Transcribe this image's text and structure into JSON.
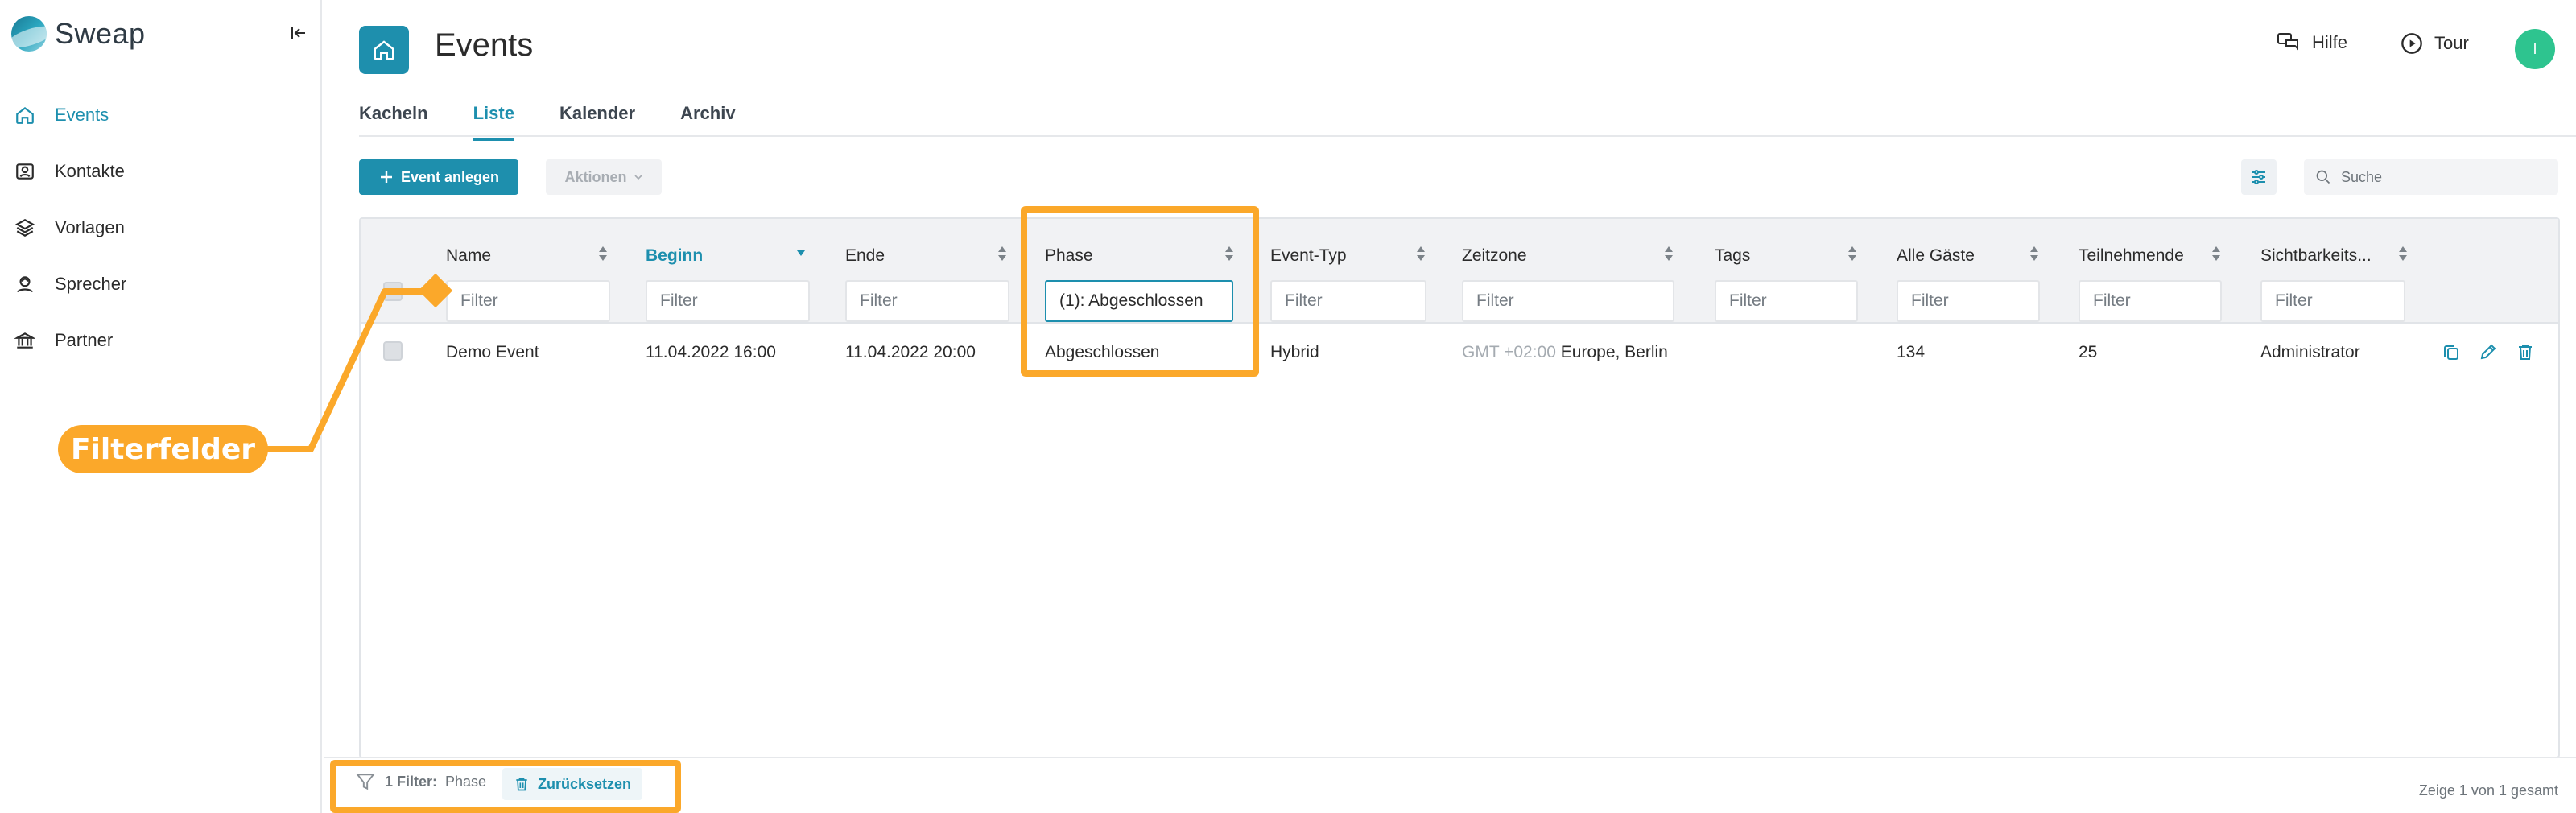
{
  "app": {
    "name": "Sweap"
  },
  "sidebar": {
    "items": [
      {
        "label": "Events",
        "icon": "home-icon",
        "active": true
      },
      {
        "label": "Kontakte",
        "icon": "contacts-icon",
        "active": false
      },
      {
        "label": "Vorlagen",
        "icon": "layers-icon",
        "active": false
      },
      {
        "label": "Sprecher",
        "icon": "speaker-icon",
        "active": false
      },
      {
        "label": "Partner",
        "icon": "bank-icon",
        "active": false
      }
    ]
  },
  "header": {
    "title": "Events",
    "help_label": "Hilfe",
    "tour_label": "Tour",
    "avatar_initial": "I"
  },
  "tabs": [
    {
      "label": "Kacheln",
      "active": false
    },
    {
      "label": "Liste",
      "active": true
    },
    {
      "label": "Kalender",
      "active": false
    },
    {
      "label": "Archiv",
      "active": false
    }
  ],
  "toolbar": {
    "create_label": "Event anlegen",
    "actions_label": "Aktionen",
    "search_placeholder": "Suche"
  },
  "table": {
    "columns": [
      {
        "title": "Name",
        "filter_placeholder": "Filter",
        "filter_value": "",
        "sorted": false
      },
      {
        "title": "Beginn",
        "filter_placeholder": "Filter",
        "filter_value": "",
        "sorted": true
      },
      {
        "title": "Ende",
        "filter_placeholder": "Filter",
        "filter_value": "",
        "sorted": false
      },
      {
        "title": "Phase",
        "filter_placeholder": "Filter",
        "filter_value": "(1): Abgeschlossen",
        "sorted": false
      },
      {
        "title": "Event-Typ",
        "filter_placeholder": "Filter",
        "filter_value": "",
        "sorted": false
      },
      {
        "title": "Zeitzone",
        "filter_placeholder": "Filter",
        "filter_value": "",
        "sorted": false
      },
      {
        "title": "Tags",
        "filter_placeholder": "Filter",
        "filter_value": "",
        "sorted": false
      },
      {
        "title": "Alle Gäste",
        "filter_placeholder": "Filter",
        "filter_value": "",
        "sorted": false
      },
      {
        "title": "Teilnehmende",
        "filter_placeholder": "Filter",
        "filter_value": "",
        "sorted": false
      },
      {
        "title": "Sichtbarkeits...",
        "filter_placeholder": "Filter",
        "filter_value": "",
        "sorted": false
      }
    ],
    "rows": [
      {
        "name": "Demo Event",
        "beginn": "11.04.2022 16:00",
        "ende": "11.04.2022 20:00",
        "phase": "Abgeschlossen",
        "event_typ": "Hybrid",
        "zeitzone_offset": "GMT +02:00",
        "zeitzone_name": "Europe, Berlin",
        "tags": "",
        "alle_gaeste": "134",
        "teilnehmende": "25",
        "sichtbarkeit": "Administrator"
      }
    ]
  },
  "footer": {
    "filter_count": "1 Filter:",
    "filter_name": "Phase",
    "reset_label": "Zurücksetzen",
    "count_text": "Zeige 1 von 1 gesamt"
  },
  "annotation": {
    "callout_label": "Filterfelder",
    "color": "#fba82a"
  },
  "colors": {
    "accent": "#1d8fae",
    "avatar": "#2ec48f"
  }
}
